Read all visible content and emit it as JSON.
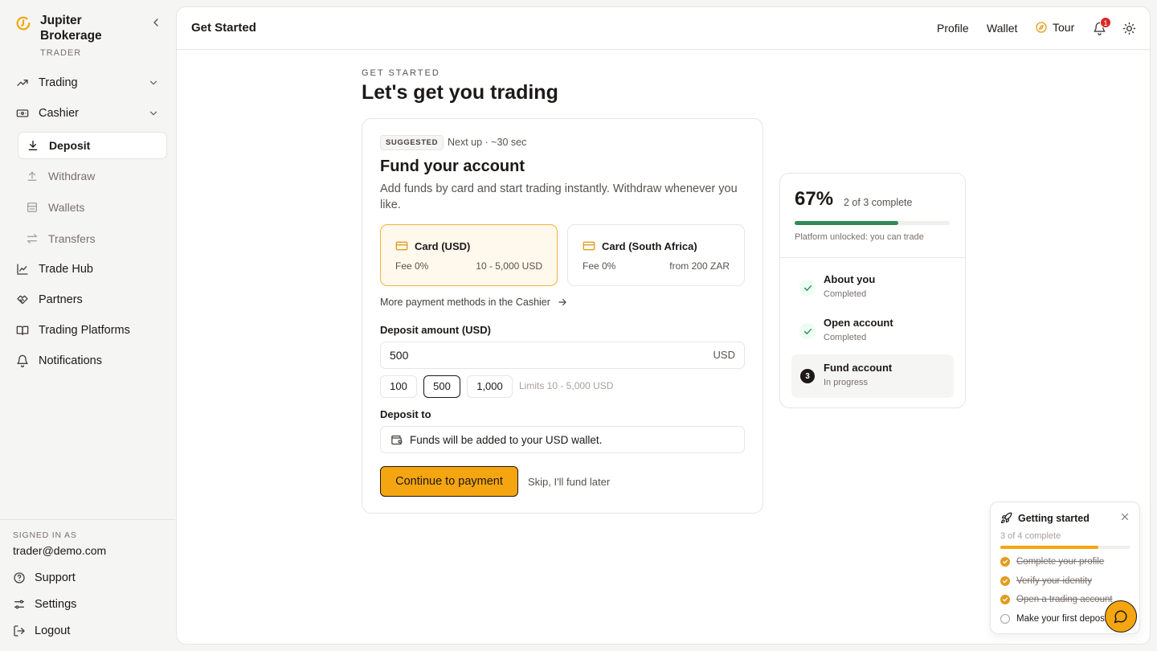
{
  "sidebar": {
    "brand_line1": "Jupiter",
    "brand_line2": "Brokerage",
    "role": "TRADER",
    "nav": [
      {
        "label": "Trading"
      },
      {
        "label": "Cashier"
      },
      {
        "label": "Deposit"
      },
      {
        "label": "Withdraw"
      },
      {
        "label": "Wallets"
      },
      {
        "label": "Transfers"
      },
      {
        "label": "Trade Hub"
      },
      {
        "label": "Partners"
      },
      {
        "label": "Trading Platforms"
      },
      {
        "label": "Notifications"
      }
    ],
    "signed_in_label": "SIGNED IN AS",
    "email": "trader@demo.com",
    "footer": [
      {
        "label": "Support"
      },
      {
        "label": "Settings"
      },
      {
        "label": "Logout"
      }
    ]
  },
  "topbar": {
    "title": "Get Started",
    "profile": "Profile",
    "wallet": "Wallet",
    "tour": "Tour",
    "notification_count": "1"
  },
  "hero": {
    "eyebrow": "GET STARTED",
    "headline": "Let's get you trading"
  },
  "fund": {
    "badge": "SUGGESTED",
    "next_up": "Next up · ~30 sec",
    "title": "Fund your account",
    "description": "Add funds by card and start trading instantly. Withdraw whenever you like.",
    "methods": [
      {
        "name": "Card (USD)",
        "fee": "Fee 0%",
        "range": "10 - 5,000 USD"
      },
      {
        "name": "Card (South Africa)",
        "fee": "Fee 0%",
        "range": "from 200 ZAR"
      }
    ],
    "more_methods": "More payment methods in the Cashier",
    "amount_label": "Deposit amount (USD)",
    "amount_value": "500",
    "currency": "USD",
    "presets": [
      "100",
      "500",
      "1,000"
    ],
    "limits": "Limits 10 - 5,000 USD",
    "deposit_to_label": "Deposit to",
    "deposit_to_text": "Funds will be added to your USD wallet.",
    "cta": "Continue to payment",
    "skip": "Skip, I'll fund later"
  },
  "progress": {
    "percent_text": "67%",
    "percent_value": 0.67,
    "summary": "2 of 3 complete",
    "unlocked": "Platform unlocked: you can trade",
    "steps": [
      {
        "title": "About you",
        "status": "Completed",
        "marker": "✓"
      },
      {
        "title": "Open account",
        "status": "Completed",
        "marker": "✓"
      },
      {
        "title": "Fund account",
        "status": "In progress",
        "marker": "3"
      }
    ]
  },
  "getting_started": {
    "title": "Getting started",
    "count": "3 of 4 complete",
    "progress_value": 0.75,
    "items": [
      {
        "label": "Complete your profile"
      },
      {
        "label": "Verify your identity"
      },
      {
        "label": "Open a trading account"
      },
      {
        "label": "Make your first deposit"
      }
    ]
  },
  "colors": {
    "accent": "#f5a50f",
    "success": "#2f8a57",
    "badge": "#dc2626"
  }
}
